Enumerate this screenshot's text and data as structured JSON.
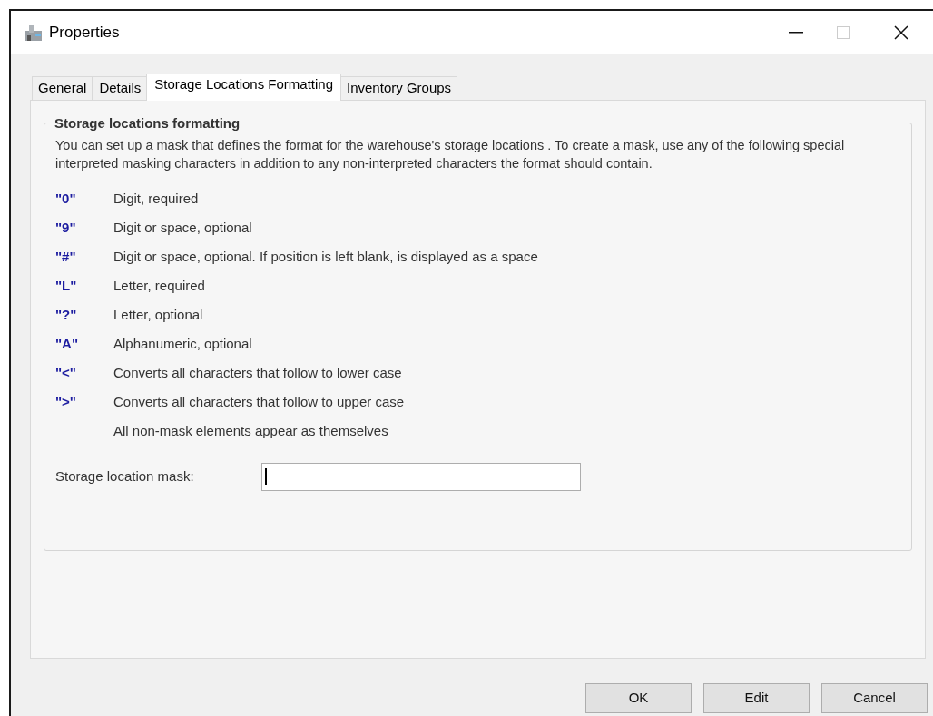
{
  "window": {
    "title": "Properties"
  },
  "tabs": [
    {
      "label": "General",
      "selected": false
    },
    {
      "label": "Details",
      "selected": false
    },
    {
      "label": "Storage Locations Formatting",
      "selected": true
    },
    {
      "label": "Inventory Groups",
      "selected": false
    }
  ],
  "group": {
    "title": "Storage locations formatting",
    "description": "You can set up a mask that defines the format for the warehouse's storage locations .  To create a mask, use any of the following special interpreted masking characters in addition to any non-interpreted characters the format should contain.",
    "mask_characters": [
      {
        "char": "\"0\"",
        "meaning": "Digit, required"
      },
      {
        "char": "\"9\"",
        "meaning": "Digit or space, optional"
      },
      {
        "char": "\"#\"",
        "meaning": "Digit or space, optional.  If position is left blank, is displayed as a space"
      },
      {
        "char": "\"L\"",
        "meaning": "Letter, required"
      },
      {
        "char": "\"?\"",
        "meaning": "Letter, optional"
      },
      {
        "char": "\"A\"",
        "meaning": "Alphanumeric, optional"
      },
      {
        "char": "\"<\"",
        "meaning": "Converts all characters that follow to lower case"
      },
      {
        "char": "\">\"",
        "meaning": "Converts all characters that follow to upper case"
      }
    ],
    "note": "All non-mask elements appear as themselves",
    "mask_field": {
      "label": "Storage location mask:",
      "focused": true
    }
  },
  "buttons": [
    "OK",
    "Edit",
    "Cancel"
  ]
}
